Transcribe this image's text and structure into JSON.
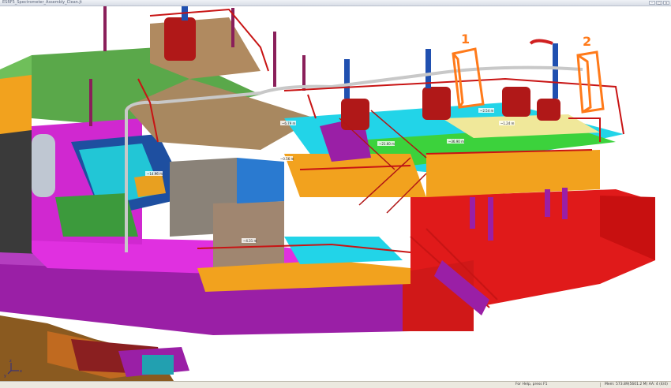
{
  "window": {
    "title": "ESRF5_Spectrometer_Assembly_Clean.jt",
    "minimize": "–",
    "maximize": "□",
    "close": "×"
  },
  "annotations": {
    "callout_1": "1",
    "callout_2": "2"
  },
  "measurements": [
    "~6.79 m",
    "~21.60 m",
    "~36.90 m",
    "~2.54 m",
    "~1.24 m",
    "~0.56 m",
    "~4.31 m",
    "~14.96 m"
  ],
  "triad": {
    "x": "x",
    "y": "y",
    "z": "z"
  },
  "statusbar": {
    "help": "For Help, press F1",
    "memory": "Mem: 573.89(5601.2 M)  AA: 4 (4/4)"
  },
  "colors": {
    "deck_magenta": "#e030e0",
    "deck_purple": "#9a1fa6",
    "hull_red": "#e01a1a",
    "deck_orange": "#f2a21e",
    "deck_green": "#5aa84a",
    "deck_cyan": "#22d4e8",
    "railing_red": "#c81414",
    "annotation_orange": "#ff7a1a"
  }
}
